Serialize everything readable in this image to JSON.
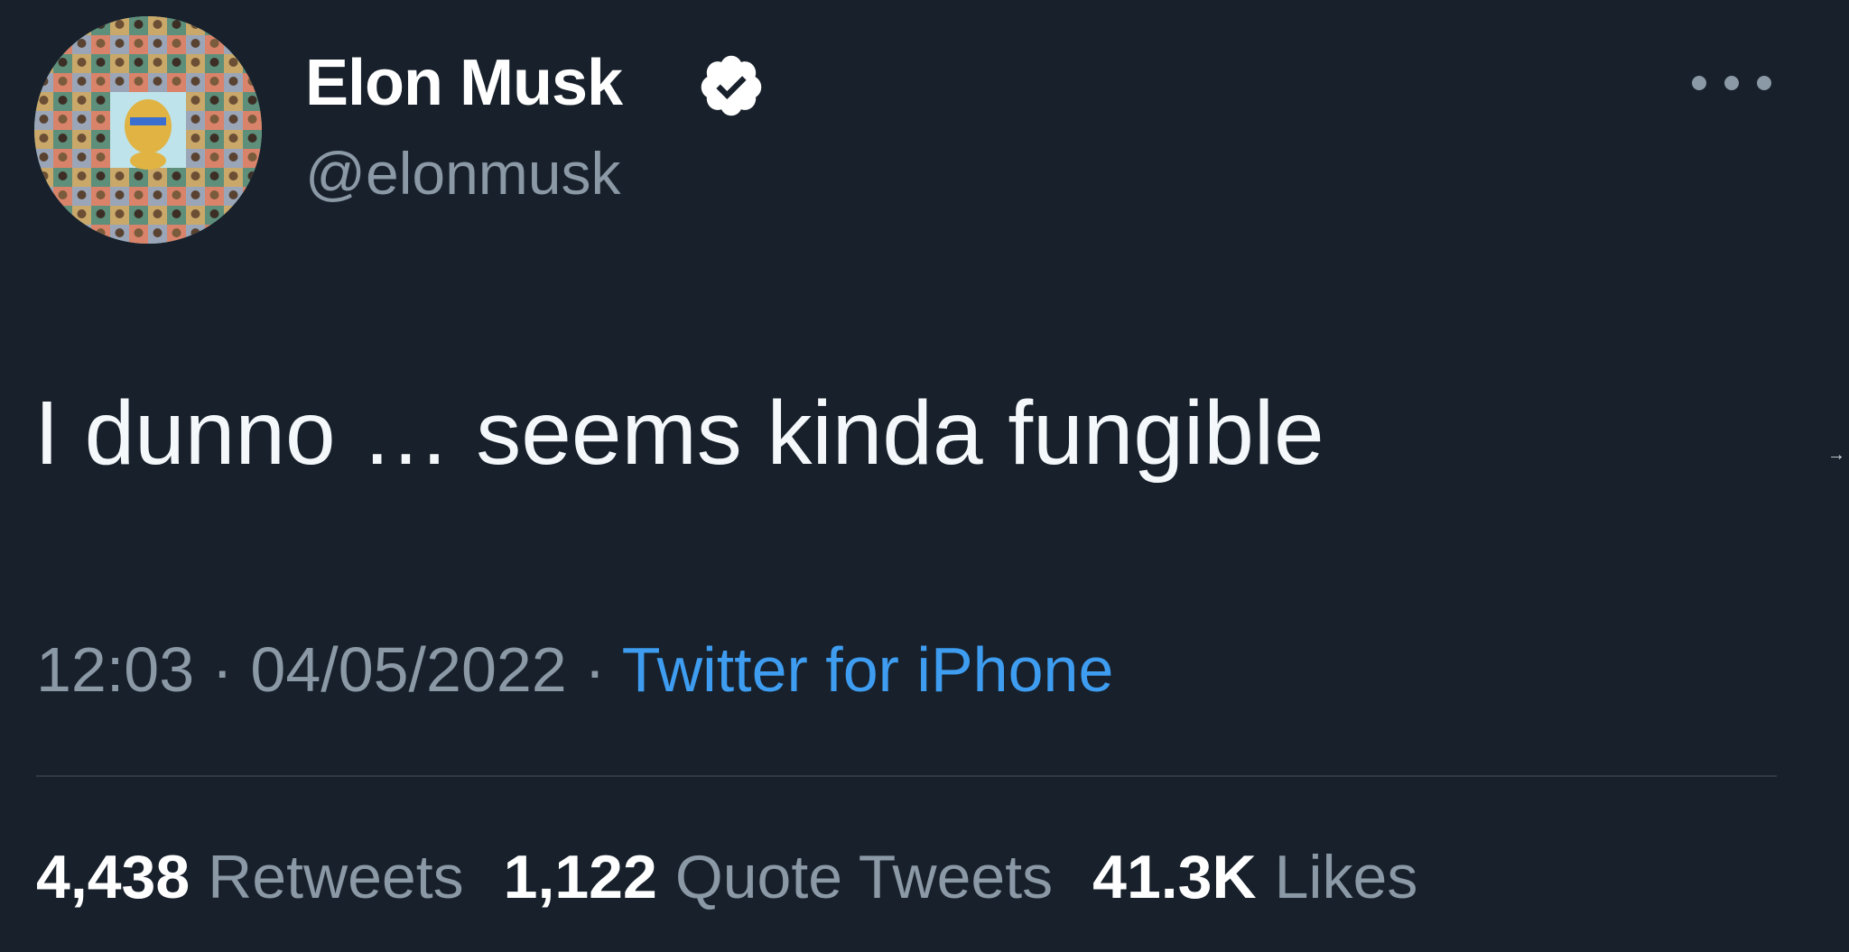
{
  "author": {
    "display_name": "Elon Musk",
    "handle": "@elonmusk",
    "verified": true
  },
  "tweet": {
    "text": "I dunno … seems kinda fungible",
    "time": "12:03",
    "date": "04/05/2022",
    "separator": "·",
    "source": "Twitter for iPhone"
  },
  "stats": {
    "retweets_count": "4,438",
    "retweets_label": "Retweets",
    "quote_count": "1,122",
    "quote_label": "Quote Tweets",
    "likes_count": "41.3K",
    "likes_label": "Likes"
  },
  "icons": {
    "more": "more-options-icon",
    "verified": "verified-badge-icon",
    "scroll": "arrow-right-icon"
  },
  "colors": {
    "background": "#17202b",
    "text_primary": "#ffffff",
    "text_secondary": "#8b98a5",
    "link": "#3e9df0",
    "divider": "#2f3a45"
  }
}
